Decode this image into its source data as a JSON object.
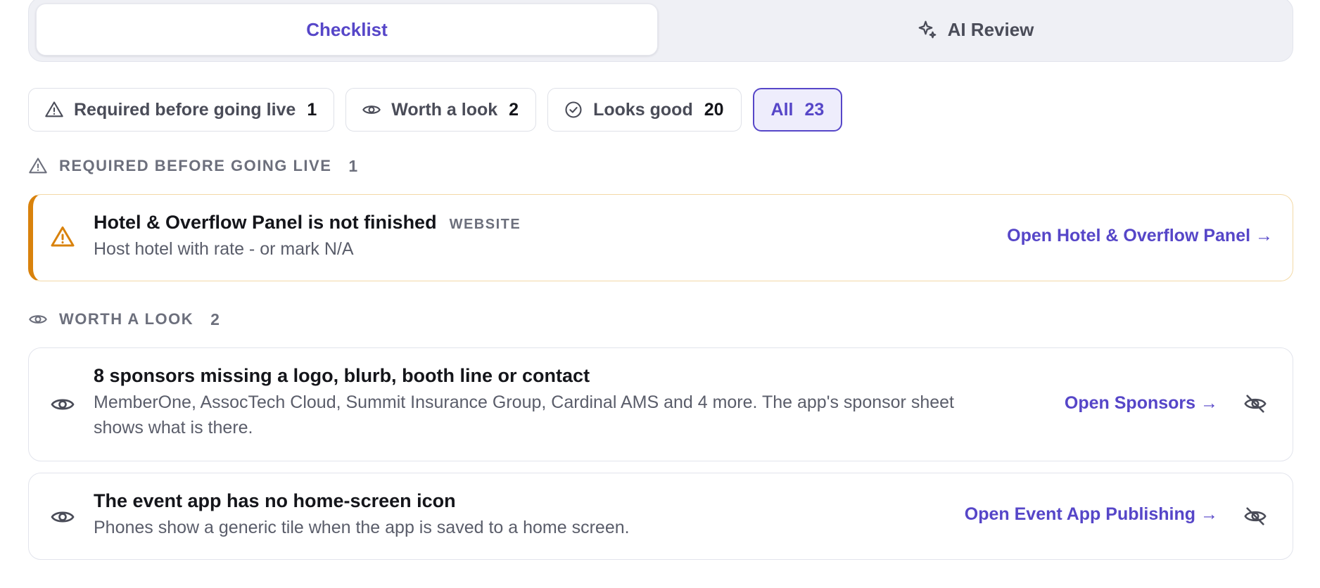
{
  "tabs": [
    {
      "label": "Checklist",
      "active": true
    },
    {
      "label": "AI Review",
      "icon": "sparkle-icon",
      "active": false
    }
  ],
  "filters": [
    {
      "label": "Required before going live",
      "count": "1",
      "icon": "warning-icon"
    },
    {
      "label": "Worth a look",
      "count": "2",
      "icon": "eye-icon"
    },
    {
      "label": "Looks good",
      "count": "20",
      "icon": "check-circle-icon"
    },
    {
      "label": "All",
      "count": "23",
      "active": true
    }
  ],
  "sections": {
    "required": {
      "label": "REQUIRED BEFORE GOING LIVE",
      "count": "1",
      "items": [
        {
          "title": "Hotel & Overflow Panel is not finished",
          "tag": "WEBSITE",
          "description": "Host hotel with rate - or mark N/A",
          "action": "Open Hotel & Overflow Panel →"
        }
      ]
    },
    "worth_a_look": {
      "label": "WORTH A LOOK",
      "count": "2",
      "items": [
        {
          "title": "8 sponsors missing a logo, blurb, booth line or contact",
          "description_line1": "MemberOne, AssocTech Cloud, Summit Insurance Group, Cardinal AMS and 4 more. The app's sponsor sheet",
          "description_line2": "shows what is there.",
          "action": "Open Sponsors →"
        },
        {
          "title": "The event app has no home-screen icon",
          "description": "Phones show a generic tile when the app is saved to a home screen.",
          "action": "Open Event App Publishing →"
        }
      ]
    }
  },
  "colors": {
    "accent": "#5646c8",
    "warning": "#d9820c",
    "muted": "#6c6f7c"
  }
}
